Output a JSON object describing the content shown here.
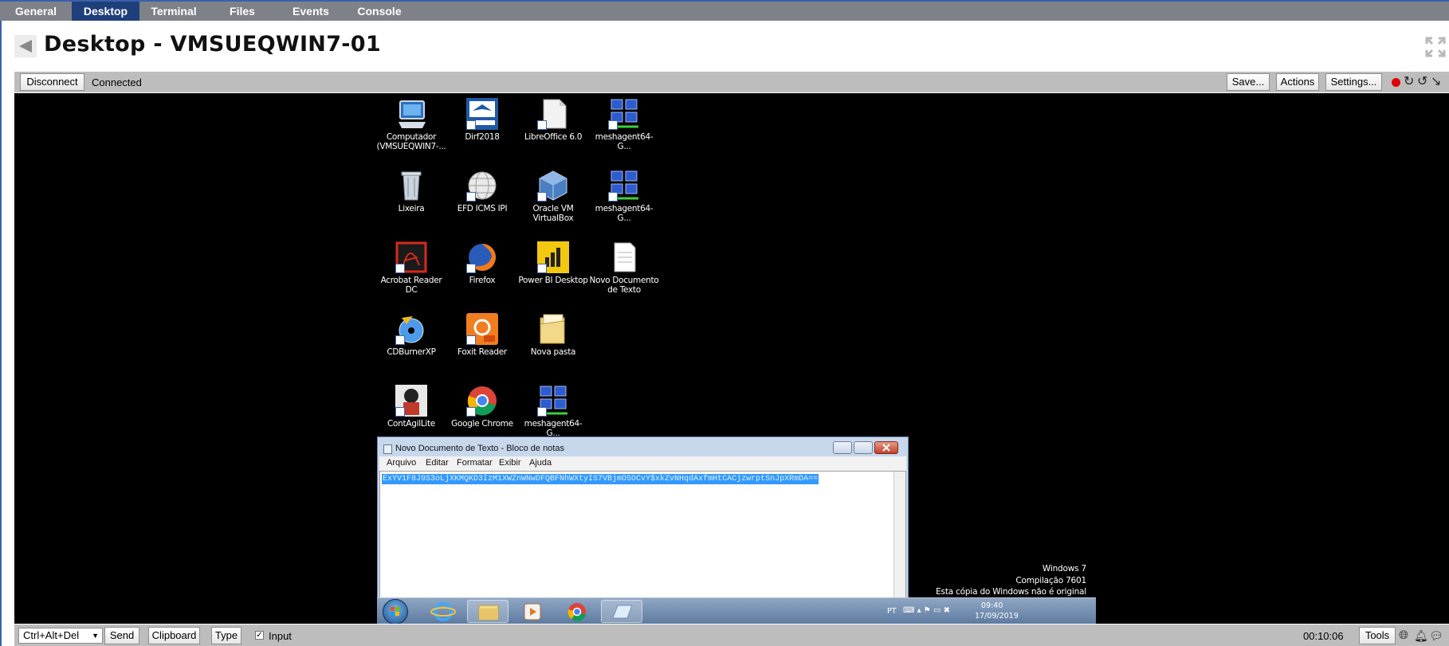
{
  "tabs": [
    {
      "label": "General"
    },
    {
      "label": "Desktop"
    },
    {
      "label": "Terminal"
    },
    {
      "label": "Files"
    },
    {
      "label": "Events"
    },
    {
      "label": "Console"
    }
  ],
  "header": {
    "title": "Desktop - VMSUEQWIN7-01"
  },
  "toolbar": {
    "disconnect_label": "Disconnect",
    "status": "Connected",
    "save_label": "Save...",
    "actions_label": "Actions",
    "settings_label": "Settings..."
  },
  "desktop": {
    "icons": [
      {
        "label": "Computador (VMSUEQWIN7-...",
        "icon": "computer-icon"
      },
      {
        "label": "Dirf2018",
        "icon": "dirf-icon"
      },
      {
        "label": "LibreOffice 6.0",
        "icon": "libreoffice-icon"
      },
      {
        "label": "meshagent64-G...",
        "icon": "meshagent-icon"
      },
      {
        "label": "Lixeira",
        "icon": "recycle-bin-icon"
      },
      {
        "label": "EFD ICMS IPI",
        "icon": "globe-icon"
      },
      {
        "label": "Oracle VM VirtualBox",
        "icon": "virtualbox-icon"
      },
      {
        "label": "meshagent64-G...",
        "icon": "meshagent-icon"
      },
      {
        "label": "Acrobat Reader DC",
        "icon": "acrobat-icon"
      },
      {
        "label": "Firefox",
        "icon": "firefox-icon"
      },
      {
        "label": "Power BI Desktop",
        "icon": "powerbi-icon"
      },
      {
        "label": "Novo Documento de Texto",
        "icon": "text-document-icon"
      },
      {
        "label": "CDBurnerXP",
        "icon": "cdburner-icon"
      },
      {
        "label": "Foxit Reader",
        "icon": "foxit-icon"
      },
      {
        "label": "Nova pasta",
        "icon": "folder-icon"
      },
      {
        "label": "ContAgilLite",
        "icon": "contagil-icon"
      },
      {
        "label": "Google Chrome",
        "icon": "chrome-icon"
      },
      {
        "label": "meshagent64-G...",
        "icon": "meshagent-icon"
      }
    ]
  },
  "notepad": {
    "title": "Novo Documento de Texto - Bloco de notas",
    "menu": [
      "Arquivo",
      "Editar",
      "Formatar",
      "Exibir",
      "Ajuda"
    ],
    "content": "ExYV1F8J9S3oLjXKMQKD3IzM1XWZnWNwDFQBFNhWXtyIS7VBjmOSOCvY$xkZvNHqdAxfmHtCACjzwrptSnJpXRmDA=="
  },
  "watermark": {
    "line1": "Windows 7",
    "line2": "Compilação 7601",
    "line3": "Esta cópia do Windows não é original"
  },
  "taskbar": {
    "lang": "PT",
    "time": "09:40",
    "date": "17/09/2019"
  },
  "bottombar": {
    "keys_selected": "Ctrl+Alt+Del",
    "send_label": "Send",
    "clipboard_label": "Clipboard",
    "type_label": "Type",
    "input_label": "Input",
    "timer": "00:10:06",
    "tools_label": "Tools"
  }
}
